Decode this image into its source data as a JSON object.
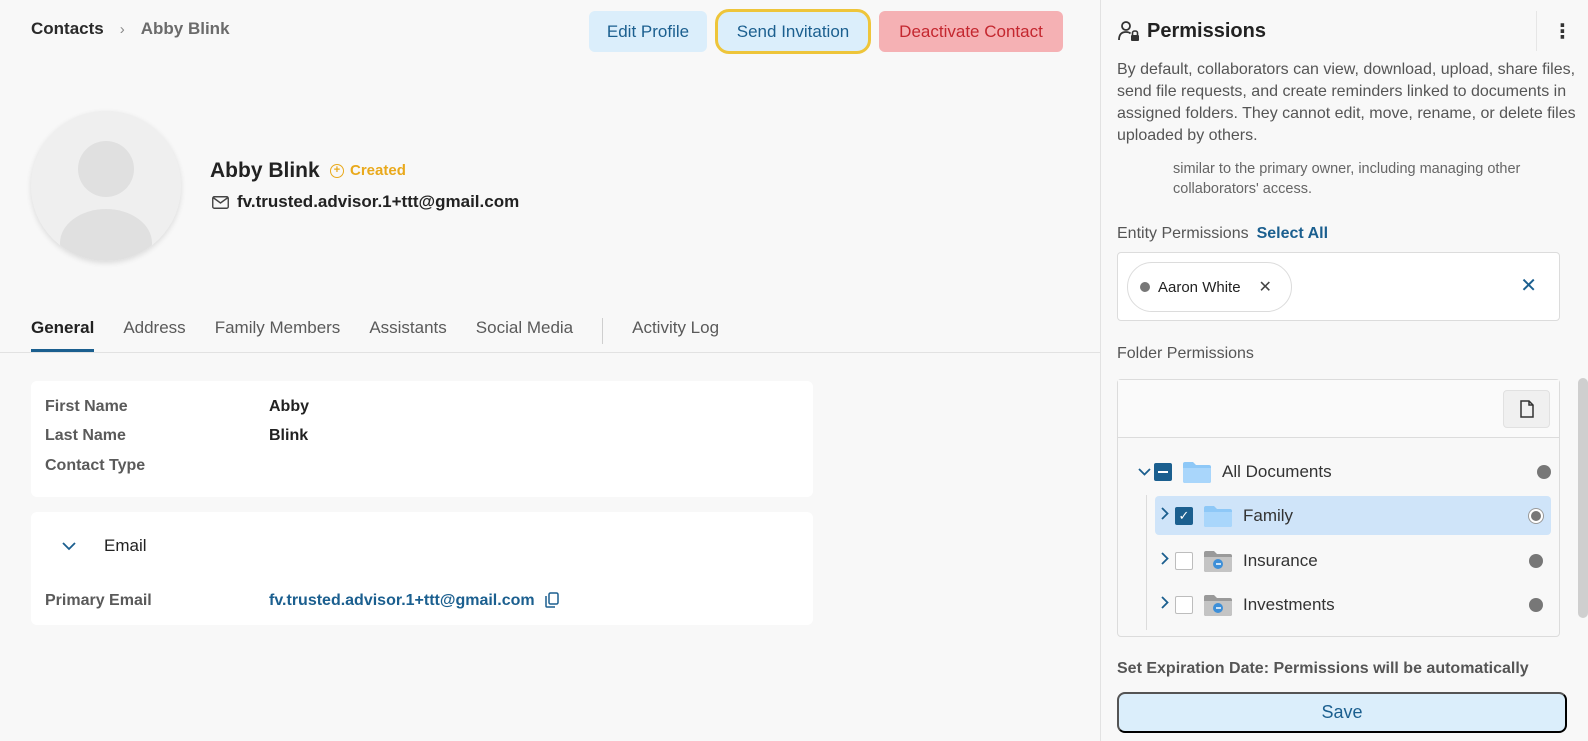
{
  "breadcrumb": {
    "root": "Contacts",
    "current": "Abby Blink"
  },
  "actions": {
    "edit": "Edit Profile",
    "invite": "Send Invitation",
    "deactivate": "Deactivate Contact"
  },
  "profile": {
    "name": "Abby Blink",
    "status": "Created",
    "email": "fv.trusted.advisor.1+ttt@gmail.com"
  },
  "tabs": [
    {
      "label": "General"
    },
    {
      "label": "Address"
    },
    {
      "label": "Family Members"
    },
    {
      "label": "Assistants"
    },
    {
      "label": "Social Media"
    },
    {
      "label": "Activity Log"
    }
  ],
  "general": {
    "first_name_label": "First Name",
    "first_name": "Abby",
    "last_name_label": "Last Name",
    "last_name": "Blink",
    "contact_type_label": "Contact Type",
    "contact_type": ""
  },
  "email_section": {
    "title": "Email",
    "primary_label": "Primary Email",
    "primary_value": "fv.trusted.advisor.1+ttt@gmail.com"
  },
  "permissions": {
    "title": "Permissions",
    "description": "By default, collaborators can view, download, upload, share files, send file requests, and create reminders linked to documents in assigned folders. They cannot edit, move, rename, or delete files uploaded by others.",
    "description2": "similar to the primary owner, including managing other collaborators' access.",
    "entity_label": "Entity Permissions",
    "select_all": "Select All",
    "entity_chip": "Aaron White",
    "folder_label": "Folder Permissions",
    "tree": [
      {
        "name": "All Documents",
        "state": "indeterminate"
      },
      {
        "name": "Family",
        "state": "checked"
      },
      {
        "name": "Insurance",
        "state": "unchecked"
      },
      {
        "name": "Investments",
        "state": "unchecked"
      }
    ],
    "expiration_text": "Set Expiration Date: Permissions will be automatically",
    "save": "Save"
  },
  "colors": {
    "accent": "#1b5f8f",
    "status": "#e9a91c",
    "danger": "#c4272f",
    "highlight": "#eec53a"
  }
}
